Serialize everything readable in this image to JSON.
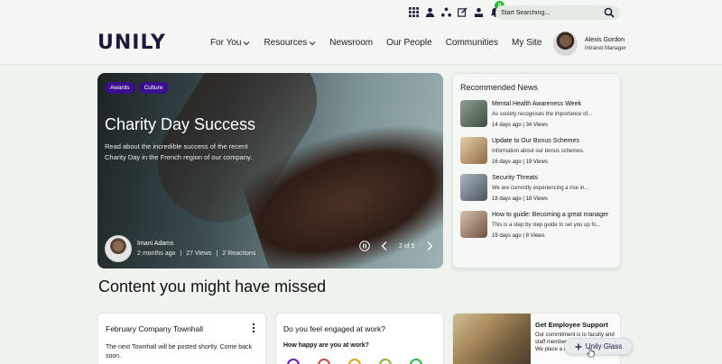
{
  "header": {
    "logo_text": "UNILY",
    "search_placeholder": "Start Searching...",
    "notification_count": "8",
    "nav": [
      {
        "label": "For You",
        "dropdown": true
      },
      {
        "label": "Resources",
        "dropdown": true
      },
      {
        "label": "Newsroom",
        "dropdown": false
      },
      {
        "label": "Our People",
        "dropdown": false
      },
      {
        "label": "Communities",
        "dropdown": false
      },
      {
        "label": "My Site",
        "dropdown": false
      }
    ],
    "profile": {
      "name": "Alexis Gordon",
      "role": "Intranet Manager"
    },
    "utility_icons": [
      "apps-grid-icon",
      "person-icon",
      "org-chart-icon",
      "edit-icon",
      "profile-alert-icon",
      "bell-icon"
    ]
  },
  "hero": {
    "tags": [
      "Awards",
      "Culture"
    ],
    "title": "Charity Day Success",
    "description": "Read about the incredible success of the recent Charity Day in the French region of our company.",
    "author": "Imani Adams",
    "time": "2 months ago",
    "views": "27 Views",
    "reactions": "2 Reactions",
    "counter": "2 of 5"
  },
  "recommended": {
    "title": "Recommended News",
    "items": [
      {
        "title": "Mental Health Awareness Week",
        "desc": "As society recognises the importance of...",
        "meta": "14 days ago | 34 Views",
        "thumb_color": "#5a6b5d"
      },
      {
        "title": "Update to Our Bonus Schemes",
        "desc": "Information about our bonus schemes.",
        "meta": "16 days ago | 19 Views",
        "thumb_color": "#b28a5e"
      },
      {
        "title": "Security Threats",
        "desc": "We are currently experiencing a rise in...",
        "meta": "18 days ago | 18 Views",
        "thumb_color": "#6e7680"
      },
      {
        "title": "How to guide: Becoming a great manager",
        "desc": "This is a step by step guide to set you up fo...",
        "meta": "19 days ago | 8 Views",
        "thumb_color": "#9c7c63"
      }
    ]
  },
  "section": {
    "title": "Content you might have missed"
  },
  "cards": {
    "townhall": {
      "title": "February Company Townhall",
      "text": "The next Townhall will be posted shortly. Come back soon."
    },
    "poll": {
      "question": "Do you feel engaged at work?",
      "sub": "How happy are you at work?",
      "face_colors": [
        "#6a1fb0",
        "#c0504a",
        "#e0a020",
        "#8ab43a",
        "#2fb24a"
      ]
    },
    "support": {
      "title": "Get Employee Support",
      "text": "Our commitment is to faculty and staff members... every stage o... We place a hig..."
    }
  },
  "glass_button": {
    "label": "Unily Glass",
    "icon": "plus-icon"
  },
  "colors": {
    "tag": "#3a0f8e",
    "badge": "#31b23a",
    "logo": "#1b1a3a"
  }
}
